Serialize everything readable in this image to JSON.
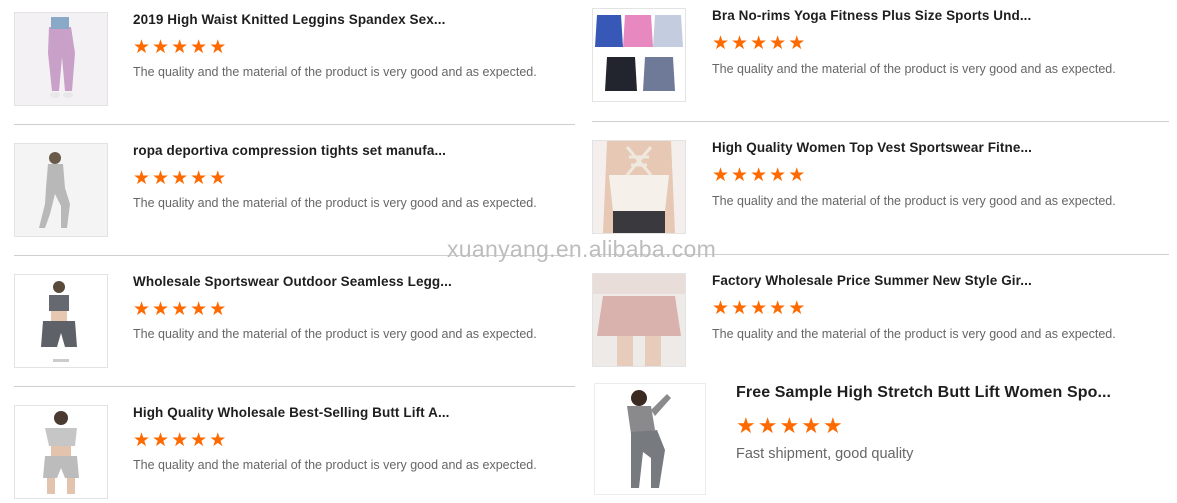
{
  "reviews_left": [
    {
      "title": "2019 High Waist Knitted Leggins Spandex Sex...",
      "stars": 5,
      "comment": "The quality and the material of the product is very good and as expected.",
      "image": "leggings-photo"
    },
    {
      "title": "ropa deportiva compression tights set manufa...",
      "stars": 5,
      "comment": "The quality and the material of the product is very good and as expected.",
      "image": "tights-set-photo"
    },
    {
      "title": "Wholesale Sportswear Outdoor Seamless Legg...",
      "stars": 5,
      "comment": "The quality and the material of the product is very good and as expected.",
      "image": "seamless-set-photo"
    },
    {
      "title": "High Quality Wholesale Best-Selling Butt Lift A...",
      "stars": 5,
      "comment": "The quality and the material of the product is very good and as expected.",
      "image": "butt-lift-set-photo"
    }
  ],
  "reviews_right": [
    {
      "title": "Bra No-rims Yoga Fitness Plus Size Sports Und...",
      "stars": 5,
      "comment": "The quality and the material of the product is very good and as expected.",
      "image": "sports-bras-photo"
    },
    {
      "title": "High Quality Women Top Vest Sportswear Fitne...",
      "stars": 5,
      "comment": "The quality and the material of the product is very good and as expected.",
      "image": "top-vest-photo"
    },
    {
      "title": "Factory Wholesale Price Summer New Style Gir...",
      "stars": 5,
      "comment": "The quality and the material of the product is very good and as expected.",
      "image": "skirt-shorts-photo"
    },
    {
      "title": "Free Sample High Stretch Butt Lift Women Spo...",
      "stars": 5,
      "comment": "Fast shipment, good quality",
      "image": "stretch-set-photo"
    }
  ],
  "watermark": "xuanyang.en.alibaba.com",
  "colors": {
    "star": "#ff6a00",
    "divider": "#cfcfcf",
    "comment": "#666666"
  }
}
